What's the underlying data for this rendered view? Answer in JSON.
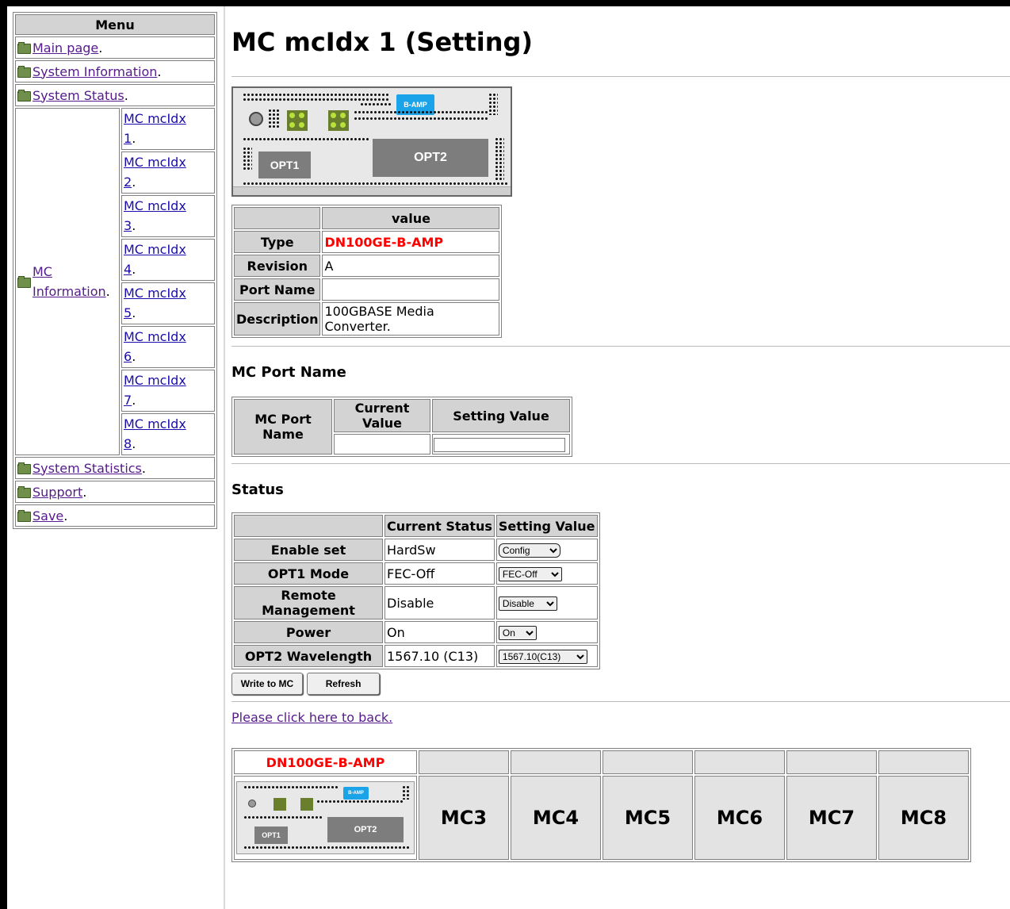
{
  "menu": {
    "title": "Menu",
    "items": [
      {
        "label": "Main page",
        "suffix": "."
      },
      {
        "label": "System Information",
        "suffix": "."
      },
      {
        "label": "System Status",
        "suffix": "."
      }
    ],
    "mc_info": {
      "label": "MC Information",
      "suffix": "."
    },
    "mc_subitems": [
      {
        "label": "MC mcIdx",
        "num": "1",
        "suffix": "."
      },
      {
        "label": "MC mcIdx",
        "num": "2",
        "suffix": "."
      },
      {
        "label": "MC mcIdx",
        "num": "3",
        "suffix": "."
      },
      {
        "label": "MC mcIdx",
        "num": "4",
        "suffix": "."
      },
      {
        "label": "MC mcIdx",
        "num": "5",
        "suffix": "."
      },
      {
        "label": "MC mcIdx",
        "num": "6",
        "suffix": "."
      },
      {
        "label": "MC mcIdx",
        "num": "7",
        "suffix": "."
      },
      {
        "label": "MC mcIdx",
        "num": "8",
        "suffix": "."
      }
    ],
    "items_after": [
      {
        "label": "System Statistics",
        "suffix": "."
      },
      {
        "label": "Support",
        "suffix": "."
      },
      {
        "label": "Save",
        "suffix": "."
      }
    ]
  },
  "page": {
    "title": "MC mcIdx 1 (Setting)"
  },
  "device_image": {
    "badge": "B-AMP",
    "opt1": "OPT1",
    "opt2": "OPT2"
  },
  "info_table": {
    "header": "value",
    "rows": [
      {
        "label": "Type",
        "value": "DN100GE-B-AMP"
      },
      {
        "label": "Revision",
        "value": "A"
      },
      {
        "label": "Port Name",
        "value": ""
      },
      {
        "label": "Description",
        "value": "100GBASE Media Converter."
      }
    ]
  },
  "port_name": {
    "heading": "MC Port Name",
    "row_label": "MC Port Name",
    "col_current": "Current Value",
    "col_setting": "Setting Value",
    "current_value": "",
    "setting_value": ""
  },
  "status": {
    "heading": "Status",
    "col_current": "Current Status",
    "col_setting": "Setting Value",
    "rows": [
      {
        "label": "Enable set",
        "current": "HardSw",
        "setting": "Config"
      },
      {
        "label": "OPT1 Mode",
        "current": "FEC-Off",
        "setting": "FEC-Off"
      },
      {
        "label": "Remote Management",
        "current": "Disable",
        "setting": "Disable"
      },
      {
        "label": "Power",
        "current": "On",
        "setting": "On"
      },
      {
        "label": "OPT2 Wavelength",
        "current": "1567.10 (C13)",
        "setting": "1567.10(C13)"
      }
    ]
  },
  "buttons": {
    "write": "Write to MC",
    "refresh": "Refresh"
  },
  "back_link": "Please click here to back.",
  "mc_overview": {
    "slot1_label": "DN100GE-B-AMP",
    "slots": [
      "MC3",
      "MC4",
      "MC5",
      "MC6",
      "MC7",
      "MC8"
    ]
  },
  "colors": {
    "type_value": "#ff0000",
    "header_bg": "#d3d3d3",
    "badge": "#1aa3e8"
  }
}
